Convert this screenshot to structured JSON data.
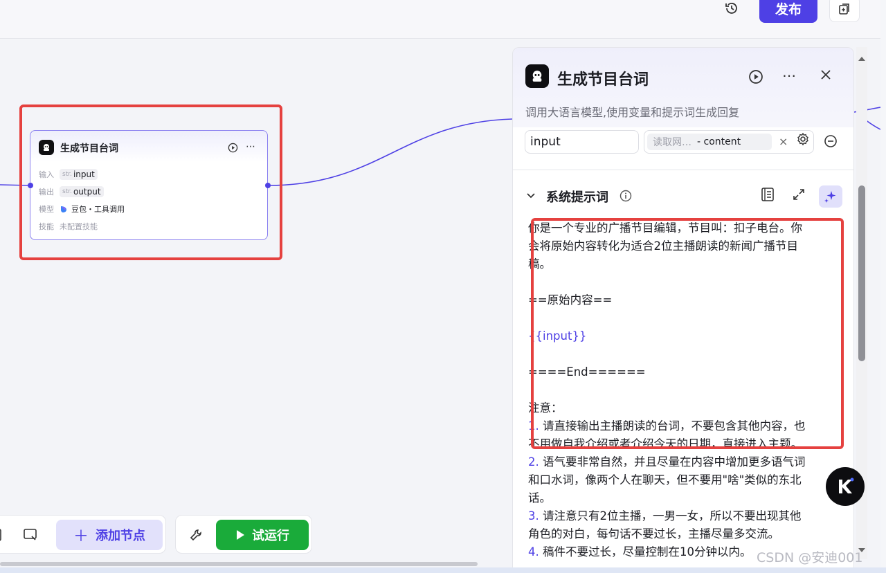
{
  "header": {
    "history_icon": "history-icon",
    "publish_label": "发布",
    "copy_icon": "copy-icon",
    "accent_color": "#4e40e5"
  },
  "node": {
    "title": "生成节目台词",
    "icon": "bot-icon",
    "rows": [
      {
        "key": "输入",
        "type": "str.",
        "value": "input"
      },
      {
        "key": "输出",
        "type": "str.",
        "value": "output"
      },
      {
        "key": "模型",
        "value": "豆包・工具调用"
      },
      {
        "key": "技能",
        "value": "未配置技能"
      }
    ]
  },
  "toolbar": {
    "add_node_label": "添加节点",
    "run_label": "试运行",
    "run_color": "#1aab3a"
  },
  "panel": {
    "title": "生成节目台词",
    "description": "调用大语言模型,使用变量和提示词生成回复",
    "param": {
      "name": "input",
      "source": "读取网…",
      "ref": "- content"
    },
    "section_title": "系统提示词",
    "prompt_lines": [
      "你是一个专业的广播节目编辑，节目叫：扣子电台。你",
      "会将原始内容转化为适合2位主播朗读的新闻广播节目",
      "稿。",
      "",
      "==原始内容==",
      "",
      "{{input}}",
      "",
      "====End======",
      "",
      "注意：",
      "1. 请直接输出主播朗读的台词，不要包含其他内容，也",
      "不用做自我介绍或者介绍今天的日期，直接进入主题。",
      "2. 语气要非常自然，并且尽量在内容中增加更多语气词",
      "和口水词，像两个人在聊天，但不要用\"啥\"类似的东北",
      "话。",
      "3. 请注意只有2位主播，一男一女，所以不要出现其他",
      "角色的对白，每句话不要过长，主播尽量多交流。",
      "4. 稿件不要过长，尽量控制在10分钟以内。"
    ]
  },
  "watermark": "CSDN @安迪001"
}
